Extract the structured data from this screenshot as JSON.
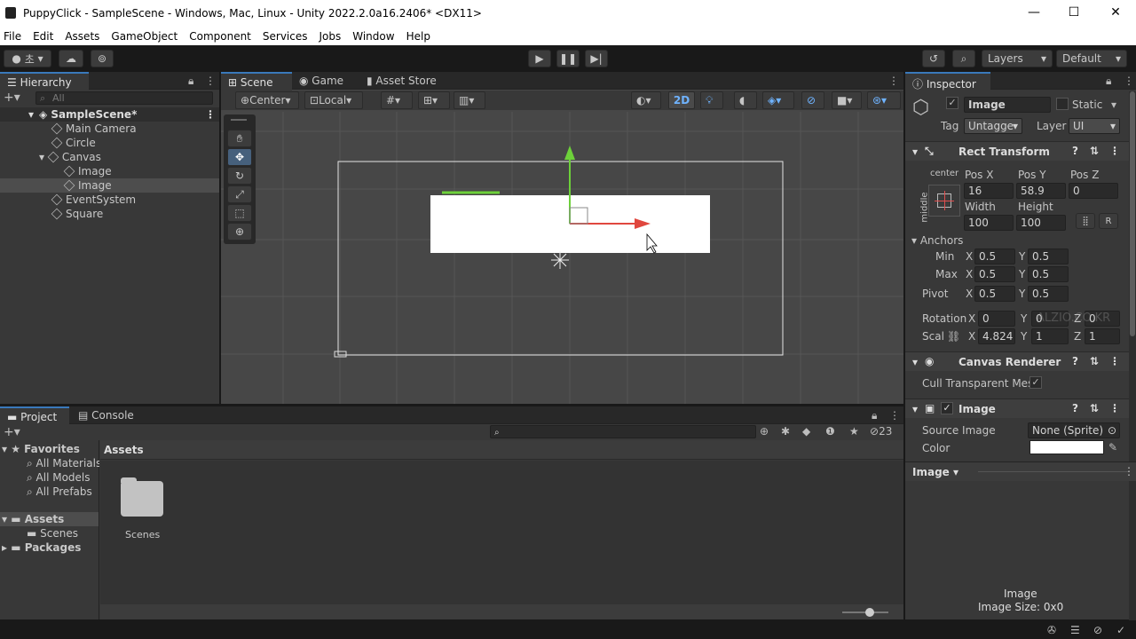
{
  "window": {
    "title": "PuppyClick - SampleScene - Windows, Mac, Linux - Unity 2022.2.0a16.2406* <DX11>"
  },
  "menu": [
    "File",
    "Edit",
    "Assets",
    "GameObject",
    "Component",
    "Services",
    "Jobs",
    "Window",
    "Help"
  ],
  "toolbar": {
    "account_label": "초",
    "layers": "Layers",
    "layout": "Default"
  },
  "hierarchy": {
    "tab": "Hierarchy",
    "search_placeholder": "All",
    "scene": "SampleScene*",
    "items": [
      "Main Camera",
      "Circle",
      "Canvas",
      "Image",
      "Image",
      "EventSystem",
      "Square"
    ]
  },
  "scene": {
    "tabs": [
      "Scene",
      "Game",
      "Asset Store"
    ],
    "pivot": "Center",
    "space": "Local",
    "mode2d": "2D"
  },
  "inspector": {
    "tab": "Inspector",
    "name": "Image",
    "static_label": "Static",
    "tag_label": "Tag",
    "tag": "Untagge",
    "layer_label": "Layer",
    "layer": "UI",
    "rect": {
      "title": "Rect Transform",
      "anchor_h": "center",
      "anchor_v": "middle",
      "posx_label": "Pos X",
      "posy_label": "Pos Y",
      "posz_label": "Pos Z",
      "posx": "16",
      "posy": "58.9",
      "posz": "0",
      "width_label": "Width",
      "height_label": "Height",
      "width": "100",
      "height": "100",
      "r_label": "R",
      "anchors_label": "Anchors",
      "min_label": "Min",
      "max_label": "Max",
      "pivot_label": "Pivot",
      "min_x": "0.5",
      "min_y": "0.5",
      "max_x": "0.5",
      "max_y": "0.5",
      "pivot_x": "0.5",
      "pivot_y": "0.5",
      "rotation_label": "Rotation",
      "rot_x": "0",
      "rot_y": "0",
      "rot_z": "0",
      "scale_label": "Scal",
      "scale_x": "4.824",
      "scale_y": "1",
      "scale_z": "1",
      "x_label": "X",
      "y_label": "Y",
      "z_label": "Z"
    },
    "canvas_renderer": {
      "title": "Canvas Renderer",
      "cull_label": "Cull Transparent Mes"
    },
    "image": {
      "title": "Image",
      "source_label": "Source Image",
      "source_value": "None (Sprite)",
      "color_label": "Color"
    },
    "preview": {
      "dropdown": "Image",
      "name": "Image",
      "size": "Image Size: 0x0"
    },
    "watermark": "ALZIO.CO.KR"
  },
  "project": {
    "tabs": [
      "Project",
      "Console"
    ],
    "favorites_label": "Favorites",
    "favorites": [
      "All Materials",
      "All Models",
      "All Prefabs"
    ],
    "assets_label": "Assets",
    "assets_children": [
      "Scenes"
    ],
    "packages_label": "Packages",
    "breadcrumb": "Assets",
    "hidden_count": "23",
    "folder": "Scenes"
  },
  "colors": {
    "accent": "#3a79bb",
    "selection": "#4d4d4d",
    "y_axis": "#6dd13a",
    "x_axis": "#e0473e"
  }
}
